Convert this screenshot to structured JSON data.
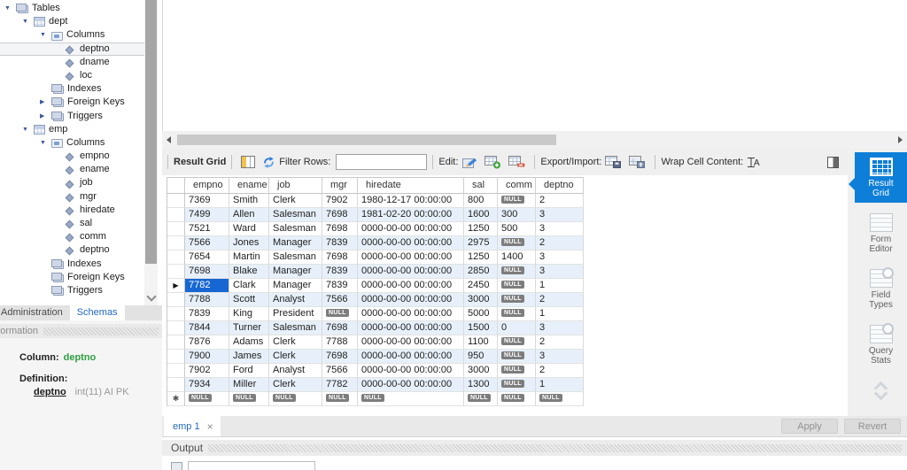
{
  "colors": {
    "sidebar_active_blue": "#0e7fd8",
    "selected_cell_blue": "#1667d3",
    "alt_row_blue": "#e7f0fa",
    "null_badge_gray": "#7d7d7d",
    "identifier_green": "#2e9e3e",
    "link_blue": "#1f68c5"
  },
  "navigator": {
    "items": [
      {
        "label": "Tables",
        "level": 0,
        "icon": "tables-icon",
        "expander": "expanded"
      },
      {
        "label": "dept",
        "level": 1,
        "icon": "table-icon",
        "expander": "expanded"
      },
      {
        "label": "Columns",
        "level": 2,
        "icon": "columns-folder-icon",
        "expander": "expanded"
      },
      {
        "label": "deptno",
        "level": 3,
        "icon": "column-icon",
        "selected": true
      },
      {
        "label": "dname",
        "level": 3,
        "icon": "column-icon"
      },
      {
        "label": "loc",
        "level": 3,
        "icon": "column-icon"
      },
      {
        "label": "Indexes",
        "level": 2,
        "icon": "indexes-icon"
      },
      {
        "label": "Foreign Keys",
        "level": 2,
        "icon": "foreign-keys-icon",
        "expander": "collapsed"
      },
      {
        "label": "Triggers",
        "level": 2,
        "icon": "triggers-icon",
        "expander": "collapsed"
      },
      {
        "label": "emp",
        "level": 1,
        "icon": "table-icon",
        "expander": "expanded"
      },
      {
        "label": "Columns",
        "level": 2,
        "icon": "columns-folder-icon",
        "expander": "expanded"
      },
      {
        "label": "empno",
        "level": 3,
        "icon": "column-icon"
      },
      {
        "label": "ename",
        "level": 3,
        "icon": "column-icon"
      },
      {
        "label": "job",
        "level": 3,
        "icon": "column-icon"
      },
      {
        "label": "mgr",
        "level": 3,
        "icon": "column-icon"
      },
      {
        "label": "hiredate",
        "level": 3,
        "icon": "column-icon"
      },
      {
        "label": "sal",
        "level": 3,
        "icon": "column-icon"
      },
      {
        "label": "comm",
        "level": 3,
        "icon": "column-icon"
      },
      {
        "label": "deptno",
        "level": 3,
        "icon": "column-icon"
      },
      {
        "label": "Indexes",
        "level": 2,
        "icon": "indexes-icon"
      },
      {
        "label": "Foreign Keys",
        "level": 2,
        "icon": "foreign-keys-icon"
      },
      {
        "label": "Triggers",
        "level": 2,
        "icon": "triggers-icon"
      }
    ]
  },
  "navigator_tabs": {
    "administration": "Administration",
    "schemas": "Schemas"
  },
  "info_panel": {
    "header": "Information",
    "column_label": "Column:",
    "column_value": "deptno",
    "definition_label": "Definition:",
    "definition_name": "deptno",
    "definition_type": "int(11) AI PK"
  },
  "editor": {
    "toolbar": {
      "result_grid_label": "Result Grid",
      "filter_rows_label": "Filter Rows:",
      "filter_input_value": "",
      "edit_label": "Edit:",
      "export_import_label": "Export/Import:",
      "wrap_cell_content_label": "Wrap Cell Content:",
      "icons": [
        "columns-layout-icon",
        "refresh-icon",
        "edit-pencil-icon",
        "add-row-icon",
        "delete-row-icon",
        "export-table-icon",
        "import-table-icon",
        "wrap-text-icon",
        "panel-toggle-icon"
      ]
    },
    "grid": {
      "columns": [
        "empno",
        "ename",
        "job",
        "mgr",
        "hiredate",
        "sal",
        "comm",
        "deptno"
      ],
      "rows": [
        [
          "7369",
          "Smith",
          "Clerk",
          "7902",
          "1980-12-17 00:00:00",
          "800",
          null,
          "2"
        ],
        [
          "7499",
          "Allen",
          "Salesman",
          "7698",
          "1981-02-20 00:00:00",
          "1600",
          "300",
          "3"
        ],
        [
          "7521",
          "Ward",
          "Salesman",
          "7698",
          "0000-00-00 00:00:00",
          "1250",
          "500",
          "3"
        ],
        [
          "7566",
          "Jones",
          "Manager",
          "7839",
          "0000-00-00 00:00:00",
          "2975",
          null,
          "2"
        ],
        [
          "7654",
          "Martin",
          "Salesman",
          "7698",
          "0000-00-00 00:00:00",
          "1250",
          "1400",
          "3"
        ],
        [
          "7698",
          "Blake",
          "Manager",
          "7839",
          "0000-00-00 00:00:00",
          "2850",
          null,
          "3"
        ],
        [
          "7782",
          "Clark",
          "Manager",
          "7839",
          "0000-00-00 00:00:00",
          "2450",
          null,
          "1"
        ],
        [
          "7788",
          "Scott",
          "Analyst",
          "7566",
          "0000-00-00 00:00:00",
          "3000",
          null,
          "2"
        ],
        [
          "7839",
          "King",
          "President",
          null,
          "0000-00-00 00:00:00",
          "5000",
          null,
          "1"
        ],
        [
          "7844",
          "Turner",
          "Salesman",
          "7698",
          "0000-00-00 00:00:00",
          "1500",
          "0",
          "3"
        ],
        [
          "7876",
          "Adams",
          "Clerk",
          "7788",
          "0000-00-00 00:00:00",
          "1100",
          null,
          "2"
        ],
        [
          "7900",
          "James",
          "Clerk",
          "7698",
          "0000-00-00 00:00:00",
          "950",
          null,
          "3"
        ],
        [
          "7902",
          "Ford",
          "Analyst",
          "7566",
          "0000-00-00 00:00:00",
          "3000",
          null,
          "2"
        ],
        [
          "7934",
          "Miller",
          "Clerk",
          "7782",
          "0000-00-00 00:00:00",
          "1300",
          null,
          "1"
        ]
      ],
      "selected": {
        "row_index": 6,
        "col_index": 0
      },
      "null_badge": "NULL",
      "current_row_marker": "▶",
      "insert_row_marker": "✱"
    },
    "result_tab": {
      "label": "emp 1",
      "close": "×"
    },
    "apply_label": "Apply",
    "revert_label": "Revert"
  },
  "right_panel": {
    "items": [
      {
        "label": "Result Grid",
        "icon": "result-grid-icon",
        "active": true
      },
      {
        "label": "Form Editor",
        "icon": "form-editor-icon"
      },
      {
        "label": "Field Types",
        "icon": "field-types-icon"
      },
      {
        "label": "Query Stats",
        "icon": "query-stats-icon"
      }
    ]
  },
  "output": {
    "label": "Output"
  }
}
